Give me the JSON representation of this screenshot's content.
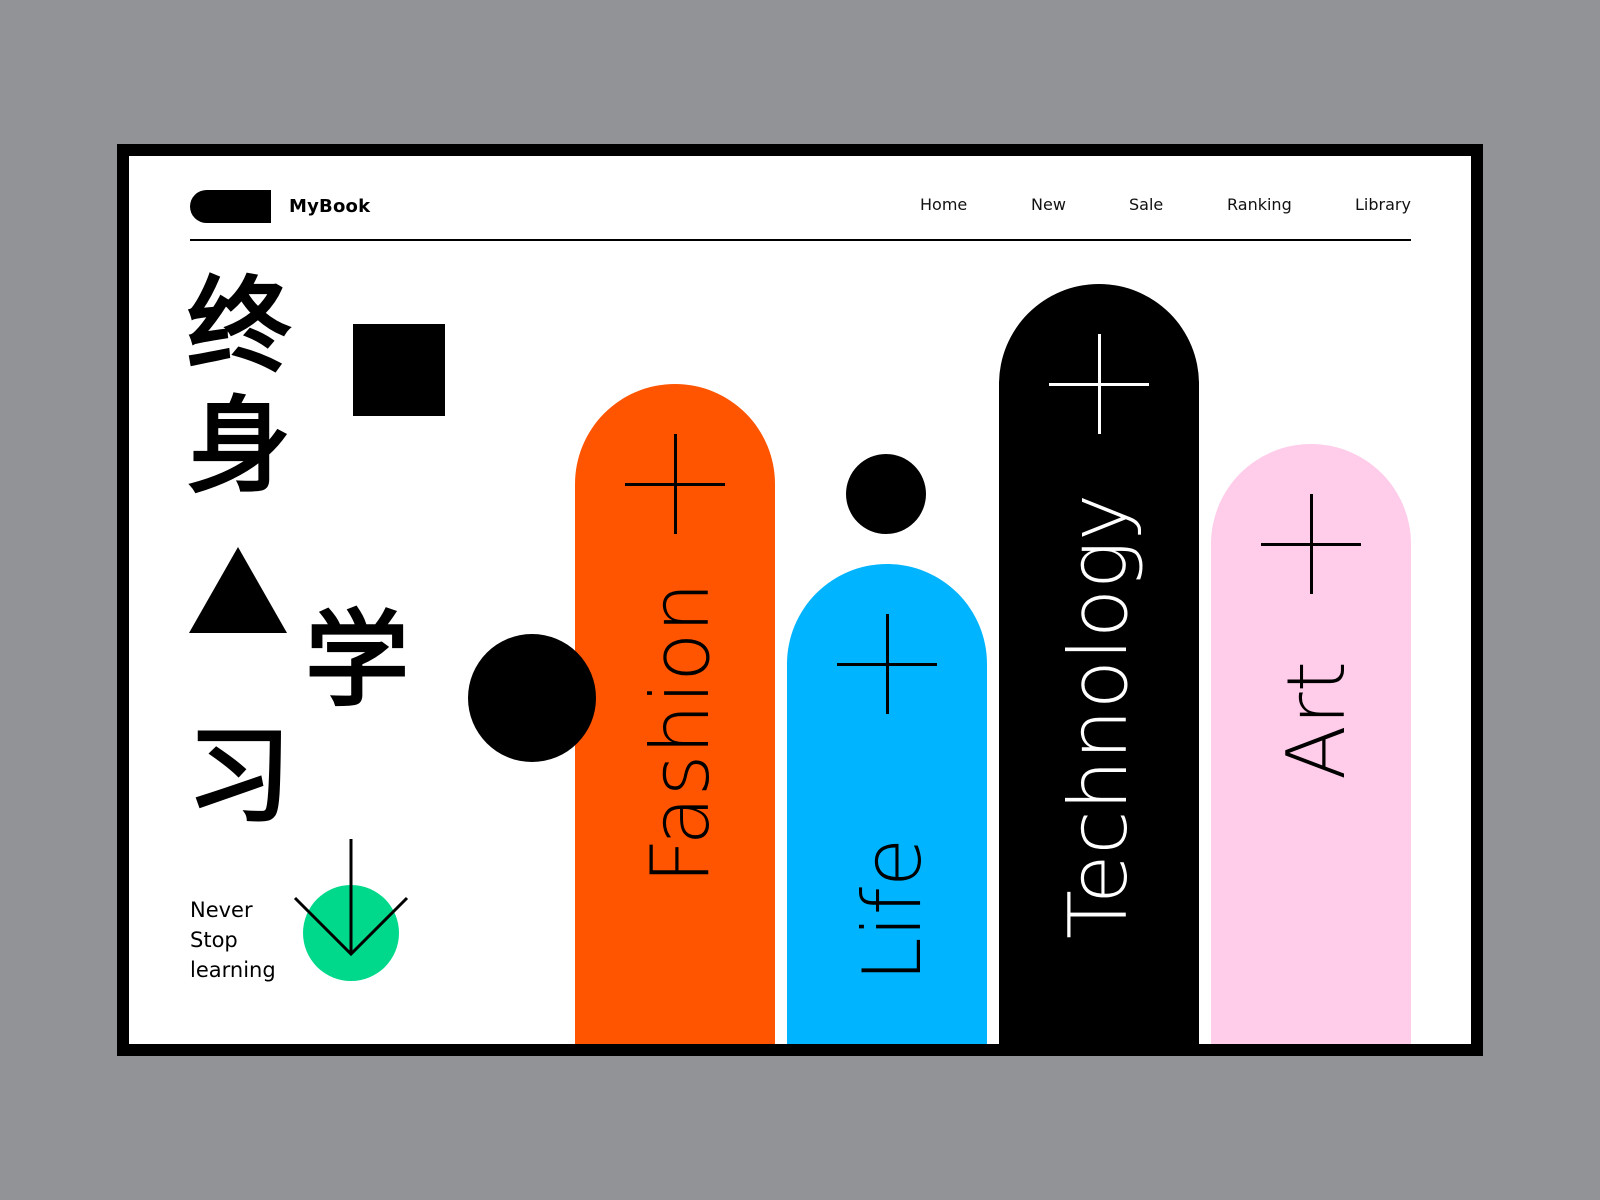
{
  "header": {
    "brand": "MyBook",
    "nav": [
      "Home",
      "New",
      "Sale",
      "Ranking",
      "Library"
    ]
  },
  "hero": {
    "cjk": [
      "终",
      "身",
      "学",
      "习"
    ],
    "tagline_lines": [
      "Never",
      "Stop",
      "learning"
    ]
  },
  "categories": [
    {
      "label": "Fashion",
      "color": "#ff5500",
      "text_color": "#000000"
    },
    {
      "label": "Life",
      "color": "#00b4ff",
      "text_color": "#000000"
    },
    {
      "label": "Technology",
      "color": "#000000",
      "text_color": "#ffffff"
    },
    {
      "label": "Art",
      "color": "#ffcce9",
      "text_color": "#000000"
    }
  ],
  "colors": {
    "background": "#929397",
    "frame": "#000000",
    "accent_green": "#00d98b"
  }
}
